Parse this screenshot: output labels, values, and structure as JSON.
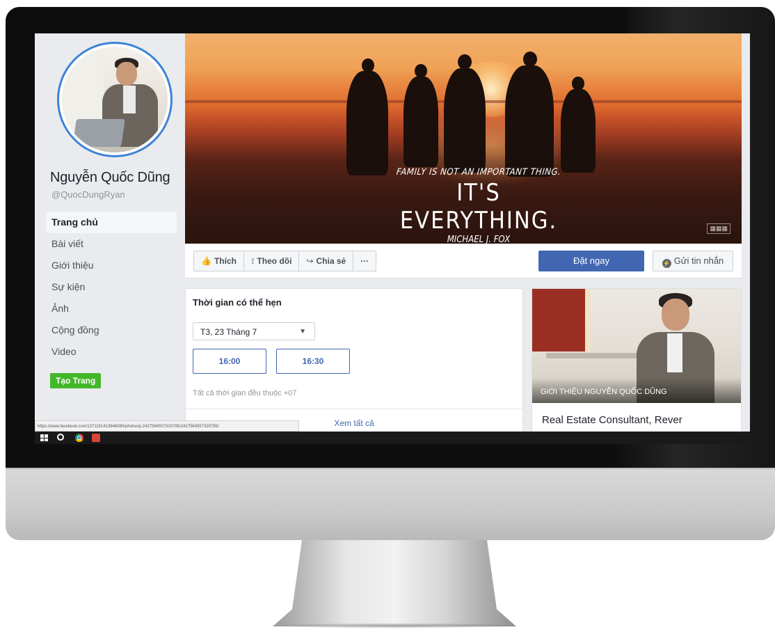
{
  "page": {
    "name": "Nguyễn Quốc Dũng",
    "handle": "@QuocDungRyan",
    "create_page_label": "Tạo Trang"
  },
  "nav": {
    "items": [
      {
        "label": "Trang chủ",
        "active": true
      },
      {
        "label": "Bài viết",
        "active": false
      },
      {
        "label": "Giới thiệu",
        "active": false
      },
      {
        "label": "Sự kiện",
        "active": false
      },
      {
        "label": "Ảnh",
        "active": false
      },
      {
        "label": "Cộng đồng",
        "active": false
      },
      {
        "label": "Video",
        "active": false
      }
    ]
  },
  "cover": {
    "quote_line1": "FAMILY IS NOT AN IMPORTANT THING.",
    "quote_line2": "IT'S EVERYTHING.",
    "quote_author": "MICHAEL J. FOX"
  },
  "actions": {
    "like_label": "Thích",
    "follow_label": "Theo dõi",
    "share_label": "Chia sẻ",
    "more_label": "···",
    "book_label": "Đặt ngay",
    "message_label": "Gửi tin nhắn"
  },
  "appointment": {
    "title": "Thời gian có thể hẹn",
    "selected_date": "T3, 23 Tháng 7",
    "slots": [
      "16:00",
      "16:30"
    ],
    "timezone_note": "Tất cả thời gian đều thuộc +07",
    "see_all_label": "Xem tất cả"
  },
  "intro": {
    "caption": "GIỚI THIỆU NGUYỄN QUỐC DŨNG",
    "role": "Real Estate Consultant, Rever"
  },
  "status_bar": {
    "url": "https://www.facebook.com/1371151413946080/photos/p.2427584557320795/2427584557320795/"
  },
  "colors": {
    "accent_blue": "#4267b2",
    "create_green": "#42b72a",
    "avatar_ring": "#3b83d6"
  },
  "icons": {
    "like": "thumbs-up-icon",
    "follow": "rss-icon",
    "share": "share-arrow-icon",
    "messenger": "messenger-icon",
    "dropdown": "caret-down-icon"
  }
}
